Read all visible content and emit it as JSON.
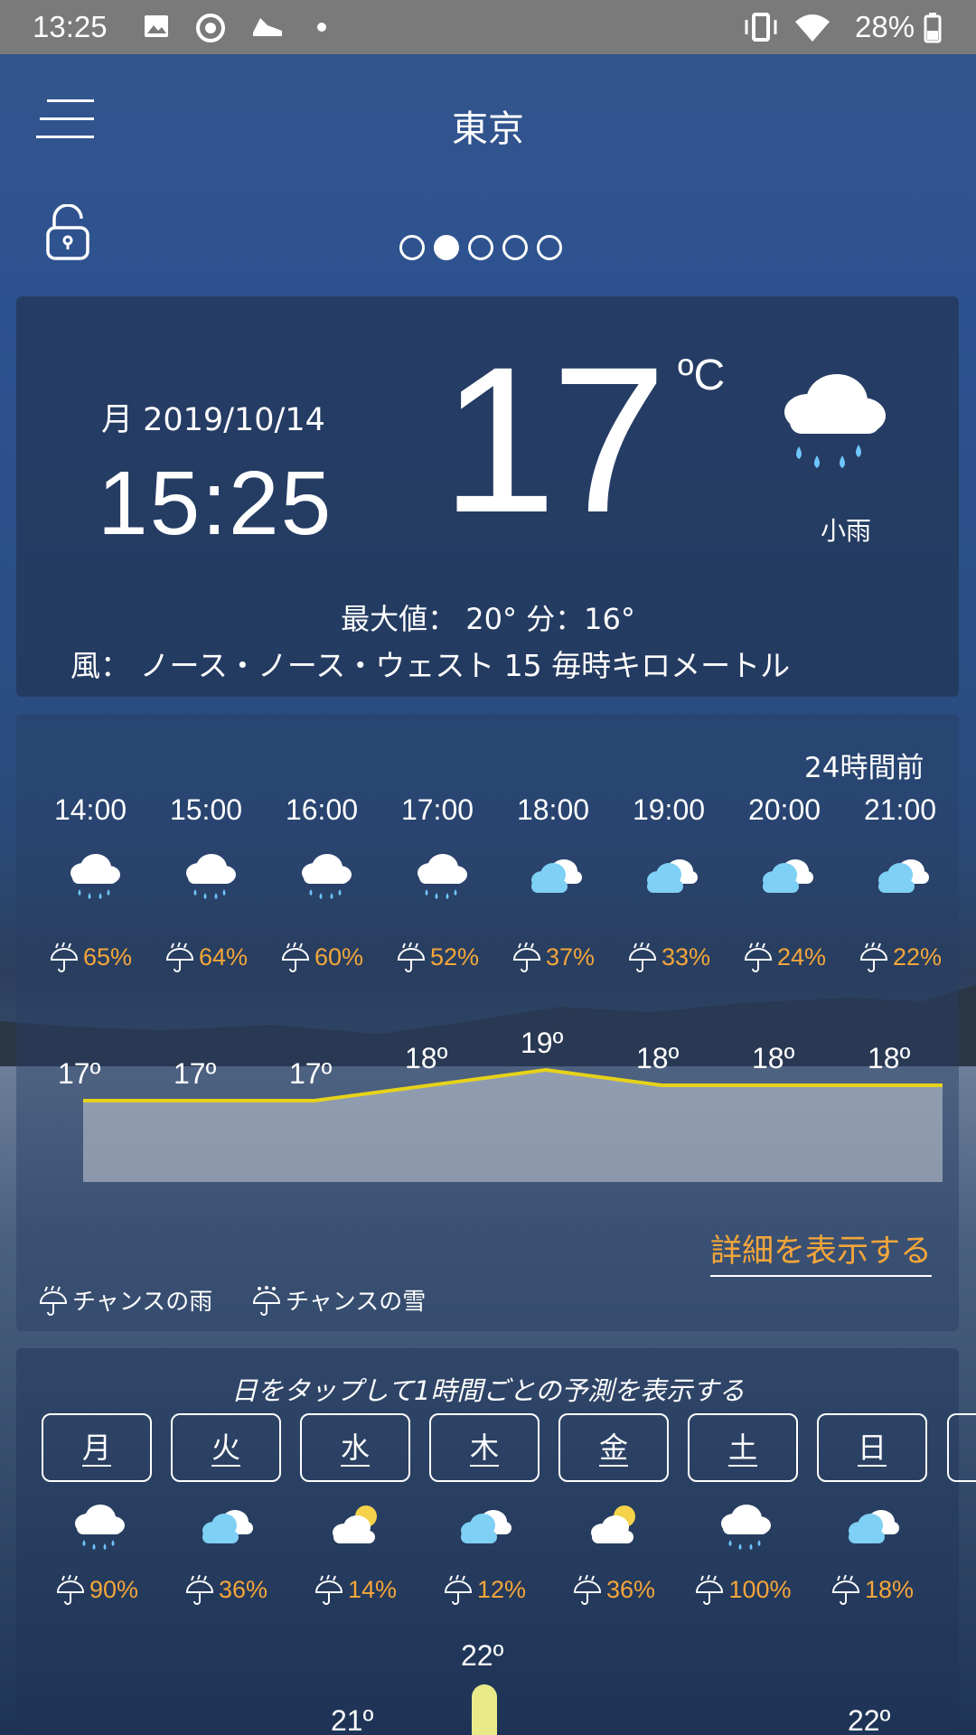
{
  "statusbar": {
    "time": "13:25",
    "battery": "28%"
  },
  "header": {
    "city": "東京"
  },
  "pager": {
    "count": 5,
    "active": 1
  },
  "current": {
    "date": "月 2019/10/14",
    "clock": "15:25",
    "temp": "17",
    "unit": "ºC",
    "condition": "小雨",
    "minmax": "最大値： 20° 分：16°",
    "wind": "風： ノース・ノース・ウェスト 15 毎時キロメートル"
  },
  "hourly": {
    "label_24h": "24時間前",
    "hours": [
      {
        "time": "14:00",
        "icon": "rain-cloud-icon",
        "prob": "65%",
        "temp": "17º",
        "temp_value": 17
      },
      {
        "time": "15:00",
        "icon": "rain-cloud-icon",
        "prob": "64%",
        "temp": "17º",
        "temp_value": 17
      },
      {
        "time": "16:00",
        "icon": "rain-cloud-icon",
        "prob": "60%",
        "temp": "17º",
        "temp_value": 17
      },
      {
        "time": "17:00",
        "icon": "rain-cloud-icon",
        "prob": "52%",
        "temp": "18º",
        "temp_value": 18
      },
      {
        "time": "18:00",
        "icon": "cloudy-icon",
        "prob": "37%",
        "temp": "19º",
        "temp_value": 19
      },
      {
        "time": "19:00",
        "icon": "cloudy-icon",
        "prob": "33%",
        "temp": "18º",
        "temp_value": 18
      },
      {
        "time": "20:00",
        "icon": "cloudy-icon",
        "prob": "24%",
        "temp": "18º",
        "temp_value": 18
      },
      {
        "time": "21:00",
        "icon": "cloudy-icon",
        "prob": "22%",
        "temp": "18º",
        "temp_value": 18
      }
    ],
    "detail_link": "詳細を表示する",
    "legend_rain": "チャンスの雨",
    "legend_snow": "チャンスの雪"
  },
  "daily": {
    "hint": "日をタップして1時間ごとの予測を表示する",
    "days": [
      {
        "day": "月",
        "icon": "rain-cloud-icon",
        "prob": "90%"
      },
      {
        "day": "火",
        "icon": "cloudy-icon",
        "prob": "36%"
      },
      {
        "day": "水",
        "icon": "partly-sunny-icon",
        "prob": "14%"
      },
      {
        "day": "木",
        "icon": "cloudy-icon",
        "prob": "12%"
      },
      {
        "day": "金",
        "icon": "partly-sunny-icon",
        "prob": "36%"
      },
      {
        "day": "土",
        "icon": "rain-cloud-icon",
        "prob": "100%"
      },
      {
        "day": "日",
        "icon": "cloudy-icon",
        "prob": "18%"
      }
    ],
    "temps": [
      "21º",
      "22º",
      "22º"
    ]
  },
  "colors": {
    "accent": "#f4a63a",
    "line": "#e6d21a"
  }
}
